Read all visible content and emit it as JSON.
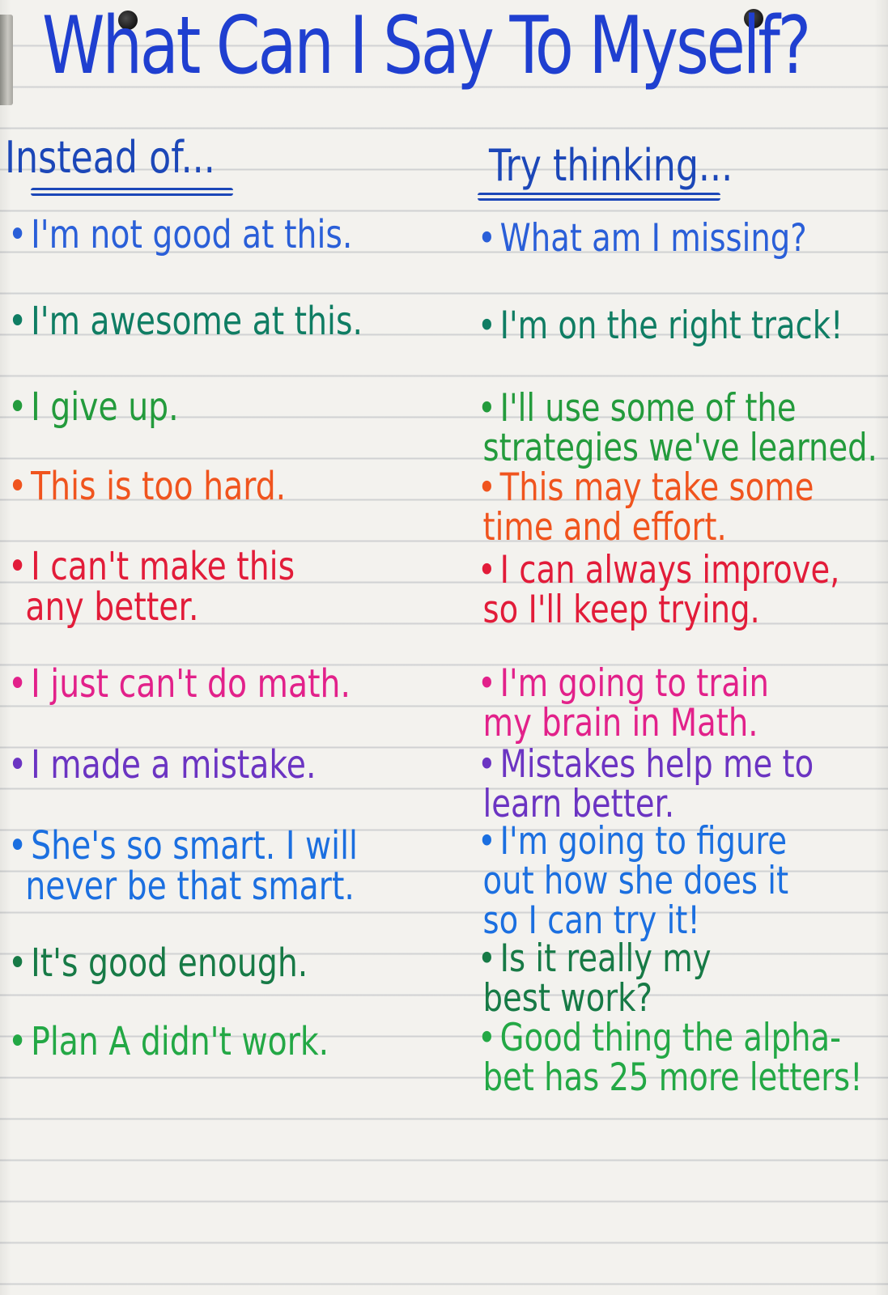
{
  "chart": {
    "title": "What Can I Say To Myself?",
    "left_header": "Instead of...",
    "right_header": "Try thinking...",
    "bullet": "•",
    "colors": {
      "title": "#1f3fd0",
      "blue": "#2a5fd8",
      "teal": "#0f7d63",
      "green": "#239b3c",
      "orange": "#f0541e",
      "red": "#e21c39",
      "pink": "#e2218a",
      "purple": "#6b34c2",
      "sky": "#1b6fe0",
      "dark_green": "#177a46",
      "lime": "#23a845"
    },
    "rows": [
      {
        "color": "blue",
        "instead_of": [
          "I'm not good at this."
        ],
        "try_thinking": [
          "What am I missing?"
        ]
      },
      {
        "color": "teal",
        "instead_of": [
          "I'm awesome at this."
        ],
        "try_thinking": [
          "I'm on the right track!"
        ]
      },
      {
        "color": "green",
        "instead_of": [
          "I give up."
        ],
        "try_thinking": [
          "I'll use some of the",
          "strategies we've learned."
        ]
      },
      {
        "color": "orange",
        "instead_of": [
          "This is too hard."
        ],
        "try_thinking": [
          "This may take some",
          "time and effort."
        ]
      },
      {
        "color": "red",
        "instead_of": [
          "I can't make this",
          "any better."
        ],
        "try_thinking": [
          "I can always improve,",
          "so I'll keep trying."
        ]
      },
      {
        "color": "pink",
        "instead_of": [
          "I just can't do math."
        ],
        "try_thinking": [
          "I'm going to train",
          "my brain in Math."
        ]
      },
      {
        "color": "purple",
        "instead_of": [
          "I made a mistake."
        ],
        "try_thinking": [
          "Mistakes help me to",
          "learn better."
        ]
      },
      {
        "color": "sky",
        "instead_of": [
          "She's so smart. I will",
          "never be that smart."
        ],
        "try_thinking": [
          "I'm going to figure",
          "out how she does it",
          "so I can try it!"
        ]
      },
      {
        "color": "dark_green",
        "instead_of": [
          "It's good enough."
        ],
        "try_thinking": [
          "Is it really my",
          "best work?"
        ]
      },
      {
        "color": "lime",
        "instead_of": [
          "Plan A didn't work."
        ],
        "try_thinking": [
          "Good thing the alpha-",
          "bet has 25 more letters!"
        ]
      }
    ]
  }
}
